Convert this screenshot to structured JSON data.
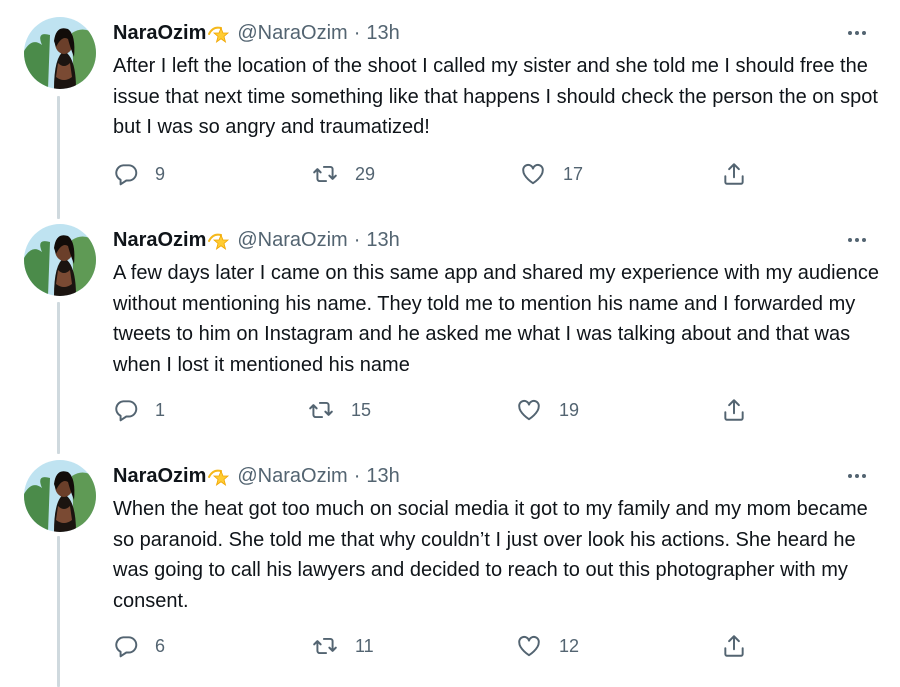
{
  "tweets": [
    {
      "name": "NaraOzim",
      "handle": "@NaraOzim",
      "dot": "·",
      "time": "13h",
      "text": "After I left the location of the shoot I called my sister and she told me I should free the issue that next time something like that happens I should check the person the on spot but I was so angry and traumatized!",
      "replies": "9",
      "retweets": "29",
      "likes": "17"
    },
    {
      "name": "NaraOzim",
      "handle": "@NaraOzim",
      "dot": "·",
      "time": "13h",
      "text": "A few days later I came on this same app and shared my experience with my audience without mentioning his name. They told me to mention his name and I forwarded my tweets to him on Instagram and he asked me what I was talking about and that was when I lost it mentioned his name",
      "replies": "1",
      "retweets": "15",
      "likes": "19"
    },
    {
      "name": "NaraOzim",
      "handle": "@NaraOzim",
      "dot": "·",
      "time": "13h",
      "text": "When the heat got too much on social media it got to my family and my mom became so paranoid. She told me that why couldn’t I just over look his actions. She heard he was going to call his lawyers and decided to reach to out this photographer with my consent.",
      "replies": "6",
      "retweets": "11",
      "likes": "12"
    }
  ],
  "icons": {
    "reply": "reply-icon",
    "retweet": "retweet-icon",
    "like": "heart-icon",
    "share": "share-icon",
    "more": "more-icon",
    "emoji": "dizzy-star-emoji"
  },
  "colors": {
    "text": "#0f1419",
    "secondary": "#536471",
    "thread_line": "#cfd9de"
  }
}
